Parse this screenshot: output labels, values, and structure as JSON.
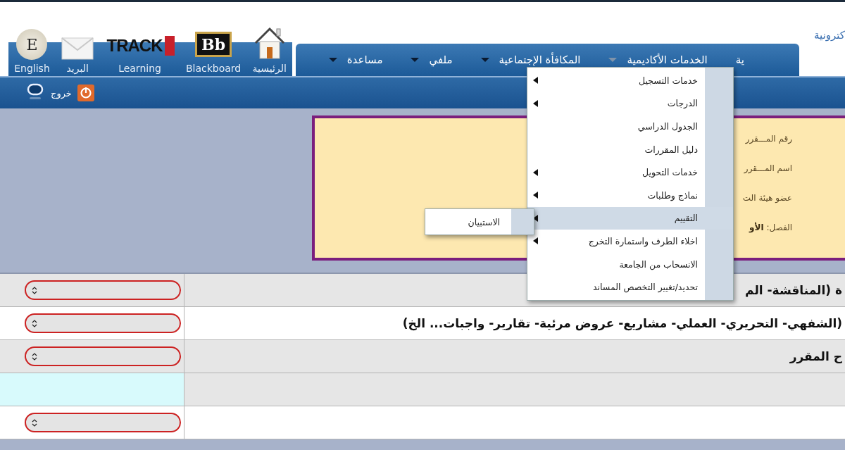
{
  "shortcuts": [
    {
      "kind": "home",
      "label": "الرئيسية"
    },
    {
      "kind": "blackboard",
      "logo_text": "Bb",
      "label": "Blackboard"
    },
    {
      "kind": "track",
      "logo_text": "TRACK",
      "label": "Learning"
    },
    {
      "kind": "mail",
      "label": "البريد"
    },
    {
      "kind": "language",
      "icon_text": "E",
      "label": "English"
    }
  ],
  "main_menu": [
    {
      "label": "ية",
      "kind": "plain",
      "expanded": false
    },
    {
      "label": "الخدمات الأكاديمية",
      "kind": "dropdown",
      "expanded": true
    },
    {
      "label": "المكافأة الإجتماعية",
      "kind": "dropdown",
      "expanded": false
    },
    {
      "label": "ملفي",
      "kind": "dropdown",
      "expanded": false
    },
    {
      "label": "مساعدة",
      "kind": "dropdown",
      "expanded": false
    }
  ],
  "portal_tab": {
    "label": "كترونية"
  },
  "toolbar": {
    "logout_label": "خروج"
  },
  "course_info": [
    {
      "label": "رقم المـــقرر"
    },
    {
      "label": "اسم المـــقرر"
    },
    {
      "label": "عضو هيئة الت"
    },
    {
      "label": "الفصل:",
      "value": "الأو"
    }
  ],
  "dropdown": [
    {
      "label": "خدمات التسجيل",
      "has_submenu": true,
      "selected": false
    },
    {
      "label": "الدرجات",
      "has_submenu": true,
      "selected": false
    },
    {
      "label": "الجدول الدراسي",
      "has_submenu": false,
      "selected": false
    },
    {
      "label": "دليل المقررات",
      "has_submenu": false,
      "selected": false
    },
    {
      "label": "خدمات التحويل",
      "has_submenu": true,
      "selected": false
    },
    {
      "label": "نماذج وطلبات",
      "has_submenu": true,
      "selected": false
    },
    {
      "label": "التقييم",
      "has_submenu": true,
      "selected": true
    },
    {
      "label": "اخلاء الطرف واستمارة التخرج",
      "has_submenu": true,
      "selected": false
    },
    {
      "label": "الانسحاب من الجامعة",
      "has_submenu": false,
      "selected": false
    },
    {
      "label": "تحديد/تغيير التخصص المساند",
      "has_submenu": false,
      "selected": false
    }
  ],
  "submenu": [
    {
      "label": "الاستبيان"
    }
  ],
  "rows": [
    {
      "text": "ة (المناقشة- الم",
      "kind": "select"
    },
    {
      "text": "(الشفهي- التحريري- العملي- مشاريع- عروض مرئية- تقارير- واجبات... الخ)",
      "kind": "select"
    },
    {
      "text": "ح المقرر",
      "kind": "select"
    },
    {
      "kind": "blank"
    },
    {
      "kind": "select"
    }
  ]
}
